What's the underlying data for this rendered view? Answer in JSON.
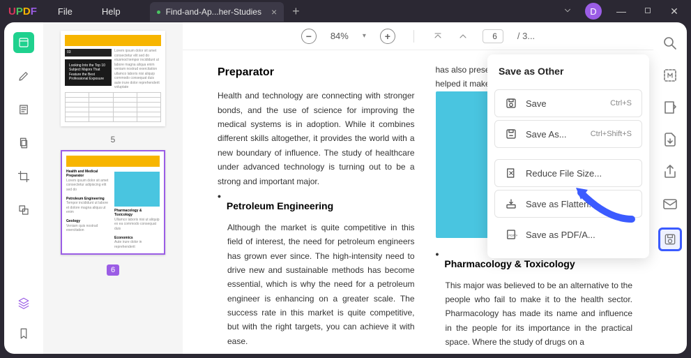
{
  "logo": {
    "u": "U",
    "p": "P",
    "d": "D",
    "f": "F"
  },
  "menu": {
    "file": "File",
    "help": "Help"
  },
  "tab": {
    "title": "Find-and-Ap...her-Studies"
  },
  "avatar": {
    "letter": "D"
  },
  "toolbar": {
    "zoom": "84%",
    "page_current": "6",
    "page_total": "/ 3..."
  },
  "thumbs": {
    "p5": {
      "num": "5",
      "black": "Looking Into the Top 10 Subject Majors That Feature the Best Professional Exposure",
      "badge": "03"
    },
    "p6": {
      "num": "6",
      "h1": "Health and Medical Preparator",
      "h2": "Petroleum Engineering",
      "h3": "Pharmacology & Toxicology",
      "h4": "Geology",
      "h5": "Economics"
    }
  },
  "doc": {
    "h1": "Preparator",
    "p1": "Health and technology are connecting with stronger bonds, and the use of science for improving the medical systems is in adoption. While it combines different skills altogether, it provides the world with a new boundary of influence. The study of healthcare under advanced technology is turning out to be a strong and important major.",
    "h2": "Petroleum Engineering",
    "p2": "Although the market is quite competitive in this field of interest, the need for petroleum engineers has grown ever since. The high-intensity need to drive new and sustainable methods has become essential, which is why the need for a petroleum engineer is enhancing on a greater scale. The success rate in this market is quite competitive, but with the right targets, you can achieve it with ease.",
    "r1": "has also presente",
    "r2": "helped it make it u",
    "h3": "Pharmacology & Toxicology",
    "p3": "This major was believed to be an alternative to the people who fail to make it to the health sector. Pharmacology has made its name and influence in the people for its importance in the practical space. Where the study of drugs on a"
  },
  "panel": {
    "title": "Save as Other",
    "save": "Save",
    "save_sc": "Ctrl+S",
    "saveas": "Save As...",
    "saveas_sc": "Ctrl+Shift+S",
    "reduce": "Reduce File Size...",
    "flatten": "Save as Flatten...",
    "pdfa": "Save as PDF/A..."
  }
}
